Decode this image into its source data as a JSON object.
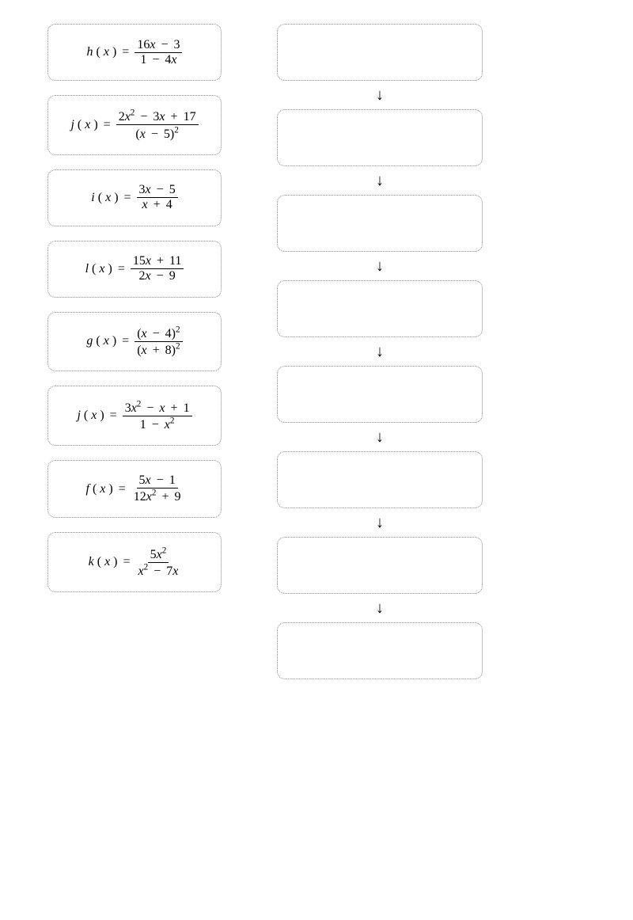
{
  "source_cards": [
    {
      "fn": "h",
      "numerator": "16x − 3",
      "denominator": "1 − 4x"
    },
    {
      "fn": "j",
      "numerator": "2x² − 3x + 17",
      "denominator": "(x − 5)²"
    },
    {
      "fn": "i",
      "numerator": "3x − 5",
      "denominator": "x + 4"
    },
    {
      "fn": "l",
      "numerator": "15x + 11",
      "denominator": "2x − 9"
    },
    {
      "fn": "g",
      "numerator": "(x − 4)²",
      "denominator": "(x + 8)²"
    },
    {
      "fn": "j",
      "numerator": "3x² − x + 1",
      "denominator": "1 − x²"
    },
    {
      "fn": "f",
      "numerator": "5x − 1",
      "denominator": "12x² + 9"
    },
    {
      "fn": "k",
      "numerator": "5x²",
      "denominator": "x² − 7x"
    }
  ],
  "drop_slot_count": 8,
  "arrow_glyph": "↓",
  "var_label": "x",
  "equals_label": "="
}
